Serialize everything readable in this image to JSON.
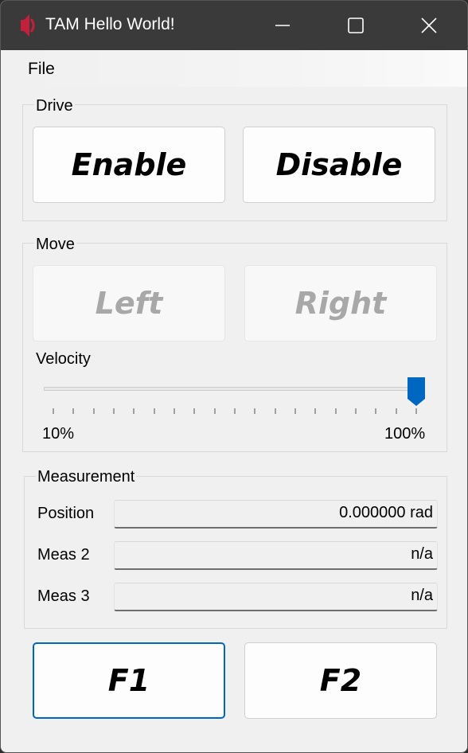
{
  "window": {
    "title": "TAM Hello World!"
  },
  "titlebar": {
    "app_icon": "app-icon",
    "minimize_icon": "minimize-icon",
    "maximize_icon": "maximize-icon",
    "close_icon": "close-icon"
  },
  "menu": {
    "file": "File"
  },
  "drive": {
    "legend": "Drive",
    "enable_label": "Enable",
    "disable_label": "Disable"
  },
  "move": {
    "legend": "Move",
    "left_label": "Left",
    "right_label": "Right",
    "velocity_label": "Velocity",
    "velocity_min_label": "10%",
    "velocity_max_label": "100%",
    "velocity_value_fraction": 1.0,
    "velocity_tick_count": 19
  },
  "measurement": {
    "legend": "Measurement",
    "rows": [
      {
        "label": "Position",
        "value": "0.000000 rad"
      },
      {
        "label": "Meas 2",
        "value": "n/a"
      },
      {
        "label": "Meas 3",
        "value": "n/a"
      }
    ]
  },
  "function_keys": {
    "f1_label": "F1",
    "f2_label": "F2"
  },
  "colors": {
    "titlebar": "#3a3a3a",
    "accent": "#0067c0",
    "app_icon": "#c4203c",
    "window_bg": "#f0f0f0"
  }
}
